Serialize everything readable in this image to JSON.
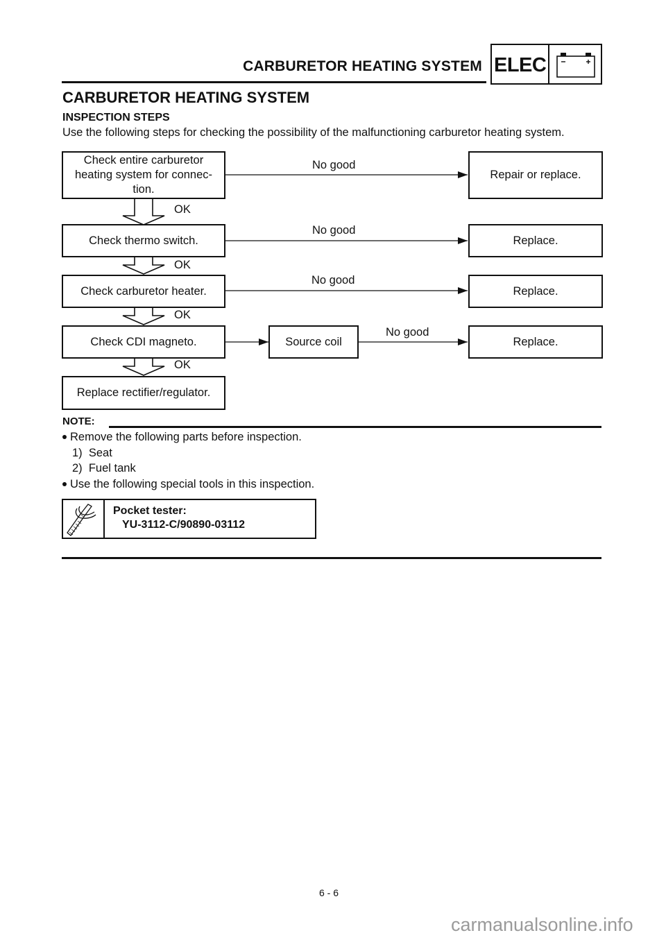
{
  "header": {
    "section_title": "CARBURETOR HEATING SYSTEM",
    "badge_label": "ELEC",
    "badge_icon": "battery-icon",
    "battery_minus": "−",
    "battery_plus": "+"
  },
  "page_title": "CARBURETOR HEATING SYSTEM",
  "subtitle": "INSPECTION STEPS",
  "intro": "Use the following steps for checking the possibility of the malfunctioning carburetor heating system.",
  "flowchart": {
    "steps": [
      {
        "label": "Check entire carburetor heating system for connec- tion.",
        "lines": [
          "Check entire carburetor",
          "heating system for connec-",
          "tion."
        ],
        "fail_label": "No good",
        "fail_result": "Repair or replace.",
        "pass_label": "OK"
      },
      {
        "label": "Check thermo switch.",
        "fail_label": "No good",
        "fail_result": "Replace.",
        "pass_label": "OK"
      },
      {
        "label": "Check carburetor heater.",
        "fail_label": "No good",
        "fail_result": "Replace.",
        "pass_label": "OK"
      },
      {
        "label": "Check CDI magneto.",
        "intermediate": "Source coil",
        "fail_label": "No good",
        "fail_result": "Replace.",
        "pass_label": "OK"
      },
      {
        "label": "Replace rectifier/regulator."
      }
    ]
  },
  "note": {
    "label": "NOTE:",
    "items": [
      {
        "type": "bullet",
        "text": "Remove the following parts before inspection."
      },
      {
        "type": "numbered",
        "text": "1)  Seat"
      },
      {
        "type": "numbered",
        "text": "2)  Fuel tank"
      },
      {
        "type": "bullet",
        "text": "Use the following special tools in this inspection."
      }
    ]
  },
  "special_tool": {
    "icon": "tool-icon",
    "name": "Pocket tester:",
    "code": "YU-3112-C/90890-03112"
  },
  "footer": {
    "page_number": "6 - 6",
    "watermark": "carmanualsonline.info"
  }
}
